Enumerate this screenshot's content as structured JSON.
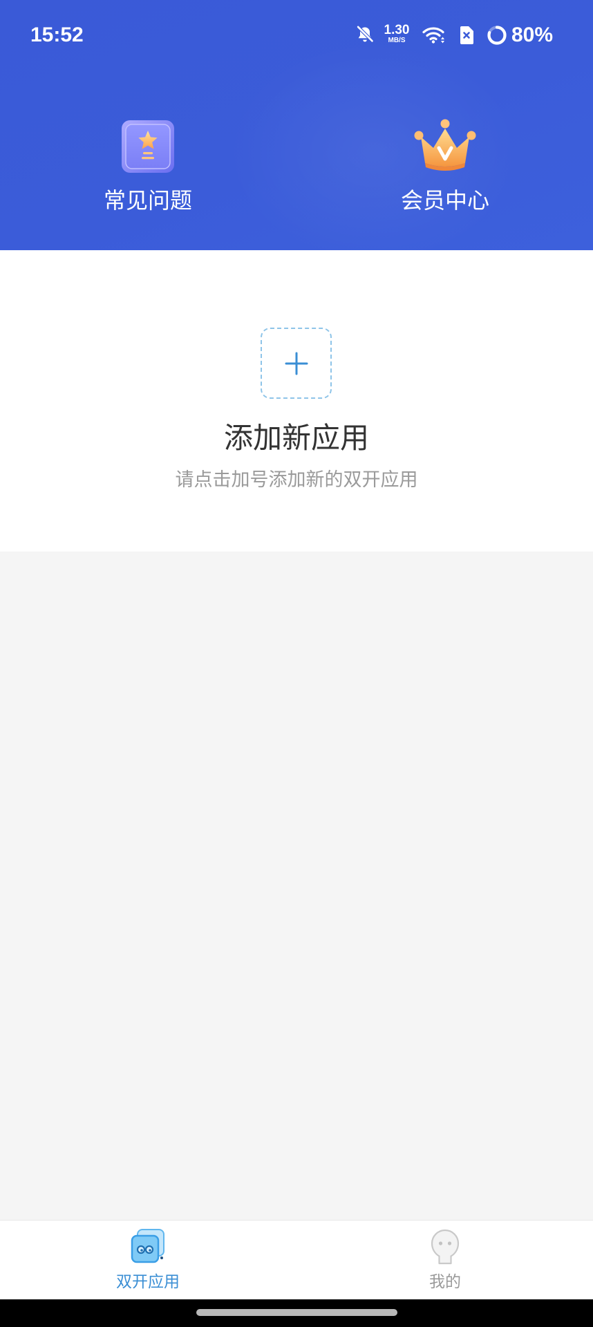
{
  "status_bar": {
    "time": "15:52",
    "network_speed": {
      "value": "1.30",
      "unit": "MB/S"
    },
    "battery_text": "80%",
    "battery_level": 0.8,
    "icons": [
      "bell-muted-icon",
      "wifi-icon",
      "sim-card-x-icon",
      "battery-ring-icon"
    ]
  },
  "header": {
    "background_color": "#3B5BD8",
    "shortcuts": [
      {
        "label": "常见问题",
        "icon": "star-trophy-icon"
      },
      {
        "label": "会员中心",
        "icon": "crown-icon"
      }
    ]
  },
  "empty_state": {
    "add_icon": "plus-icon",
    "title": "添加新应用",
    "subtitle": "请点击加号添加新的双开应用",
    "accent_color": "#3A8ED4"
  },
  "bottom_nav": {
    "active_color": "#3A8ED4",
    "inactive_color": "#9A9A9A",
    "tabs": [
      {
        "label": "双开应用",
        "icon": "dual-apps-icon",
        "active": true
      },
      {
        "label": "我的",
        "icon": "profile-icon",
        "active": false
      }
    ]
  }
}
